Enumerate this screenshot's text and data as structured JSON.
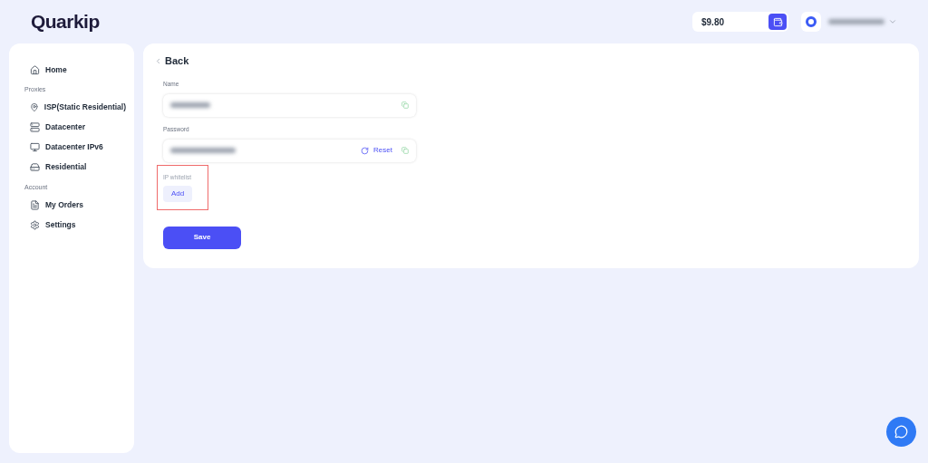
{
  "logo": "Quarkip",
  "header": {
    "balance": "$9.80"
  },
  "sidebar": {
    "sections": [
      {
        "items": [
          {
            "label": "Home",
            "kind": "home",
            "selected": false
          }
        ]
      },
      {
        "title": "Proxies",
        "items": [
          {
            "label": "ISP(Static Residential)",
            "kind": "pin",
            "selected": false
          },
          {
            "label": "Datacenter",
            "kind": "server",
            "selected": false
          },
          {
            "label": "Datacenter IPv6",
            "kind": "monitor",
            "selected": false
          },
          {
            "label": "Residential",
            "kind": "drive",
            "selected": false
          }
        ]
      },
      {
        "title": "Account",
        "items": [
          {
            "label": "My Orders",
            "kind": "list",
            "selected": false
          },
          {
            "label": "Settings",
            "kind": "gear",
            "selected": false
          }
        ]
      }
    ]
  },
  "form": {
    "back": "Back",
    "name": {
      "label": "Name"
    },
    "password": {
      "label": "Password",
      "reset": "Reset"
    },
    "whitelist": {
      "label": "IP whitelist",
      "add": "Add",
      "highlighted": true
    },
    "save": "Save"
  }
}
